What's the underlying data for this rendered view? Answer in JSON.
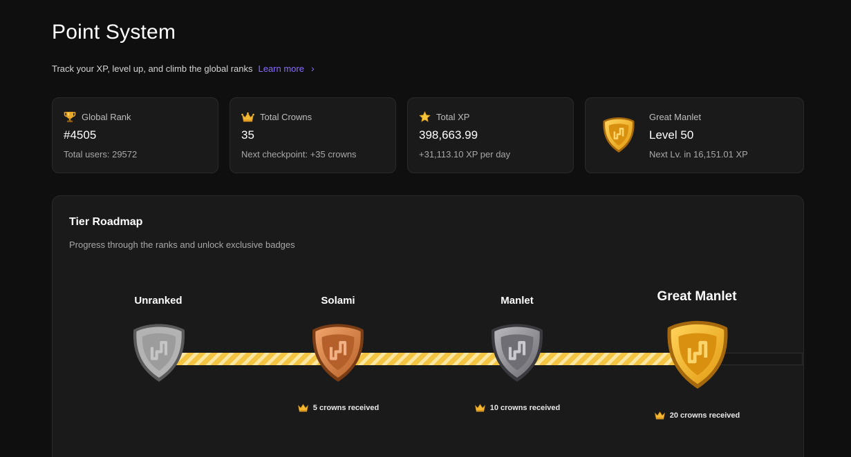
{
  "header": {
    "title": "Point System",
    "subtitle": "Track your XP, level up, and climb the global ranks",
    "learn_more": "Learn more",
    "chevron": "›"
  },
  "stats": {
    "global_rank": {
      "label": "Global Rank",
      "value": "#4505",
      "sub": "Total users: 29572",
      "icon": "trophy-icon"
    },
    "total_crowns": {
      "label": "Total Crowns",
      "value": "35",
      "sub": "Next checkpoint: +35 crowns",
      "icon": "crown-icon"
    },
    "total_xp": {
      "label": "Total XP",
      "value": "398,663.99",
      "sub": "+31,113.10 XP per day",
      "icon": "star-icon"
    },
    "level": {
      "label": "Great Manlet",
      "value": "Level 50",
      "sub": "Next Lv. in 16,151.01 XP",
      "icon": "gold-shield-icon"
    }
  },
  "roadmap": {
    "title": "Tier Roadmap",
    "subtitle": "Progress through the ranks and unlock exclusive badges",
    "progress_fraction": 0.82,
    "tiers": [
      {
        "name": "Unranked",
        "crowns": "",
        "style": "gray"
      },
      {
        "name": "Solami",
        "crowns": "5 crowns received",
        "style": "bronze"
      },
      {
        "name": "Manlet",
        "crowns": "10 crowns received",
        "style": "silver"
      },
      {
        "name": "Great Manlet",
        "crowns": "20 crowns received",
        "style": "gold"
      }
    ]
  },
  "colors": {
    "accent": "#8b6cff",
    "gold": "#f4c542",
    "background": "#0f0f0f",
    "card": "#1a1a1a"
  }
}
